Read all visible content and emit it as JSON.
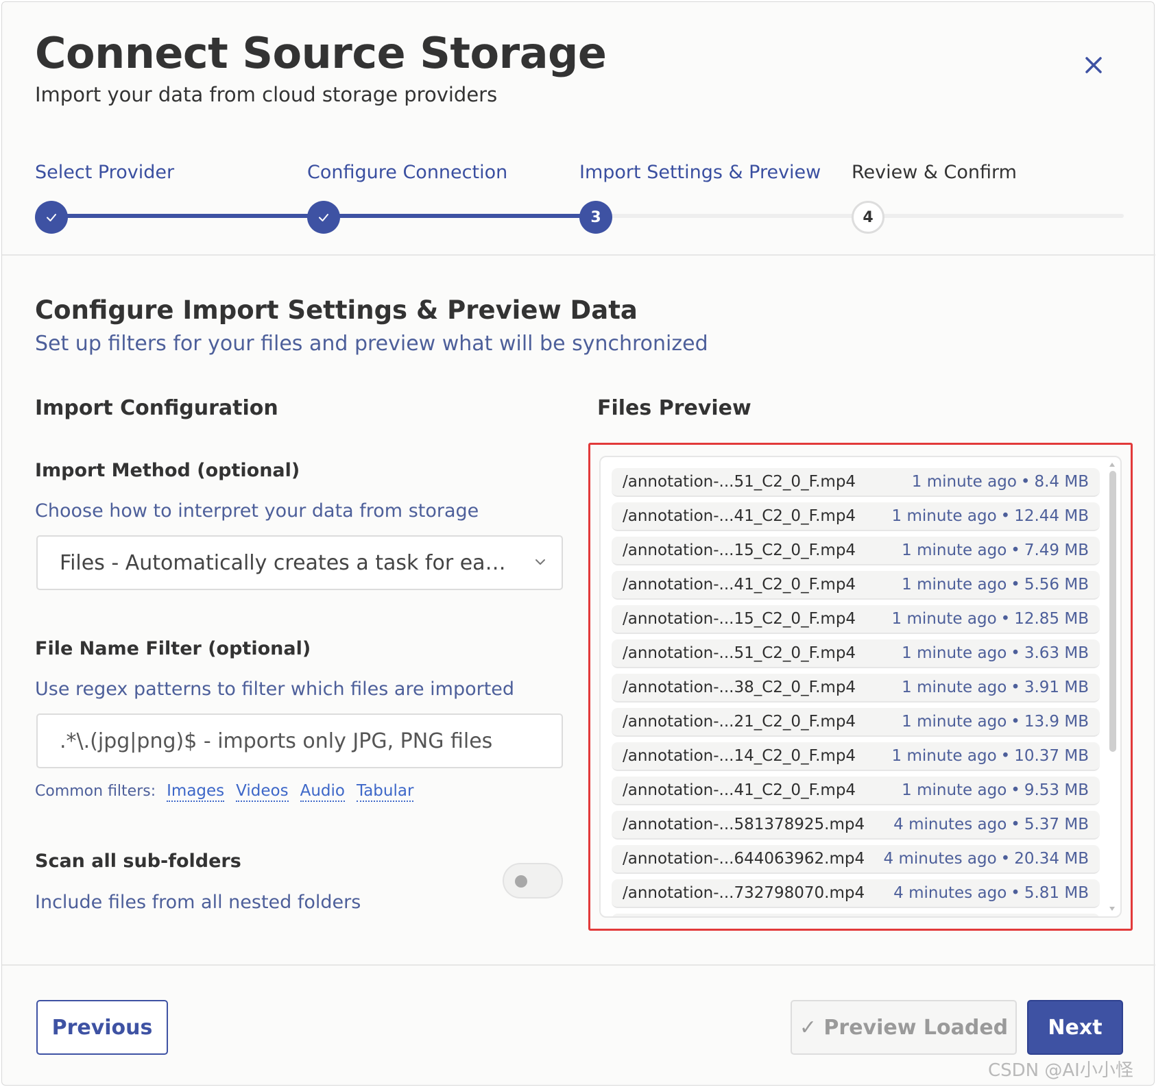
{
  "dialog": {
    "title": "Connect Source Storage",
    "subtitle": "Import your data from cloud storage providers"
  },
  "steps": [
    {
      "label": "Select Provider",
      "state": "complete",
      "marker": "✓"
    },
    {
      "label": "Configure Connection",
      "state": "complete",
      "marker": "✓"
    },
    {
      "label": "Import Settings & Preview",
      "state": "active",
      "marker": "3"
    },
    {
      "label": "Review & Confirm",
      "state": "pending",
      "marker": "4"
    }
  ],
  "section": {
    "title": "Configure Import Settings & Preview Data",
    "subtitle": "Set up filters for your files and preview what will be synchronized"
  },
  "import_config": {
    "heading": "Import Configuration",
    "method": {
      "label": "Import Method (optional)",
      "help": "Choose how to interpret your data from storage",
      "selected": "Files - Automatically creates a task for each s..."
    },
    "filter": {
      "label": "File Name Filter (optional)",
      "help": "Use regex patterns to filter which files are imported",
      "placeholder": ".*\\.(jpg|png)$ - imports only JPG, PNG files",
      "common_label": "Common filters:",
      "common": [
        "Images",
        "Videos",
        "Audio",
        "Tabular"
      ]
    },
    "scan": {
      "label": "Scan all sub-folders",
      "help": "Include files from all nested folders",
      "enabled": false
    }
  },
  "preview": {
    "heading": "Files Preview",
    "files": [
      {
        "name": "/annotation-...51_C2_0_F.mp4",
        "time": "1 minute ago",
        "size": "8.4 MB"
      },
      {
        "name": "/annotation-...41_C2_0_F.mp4",
        "time": "1 minute ago",
        "size": "12.44 MB"
      },
      {
        "name": "/annotation-...15_C2_0_F.mp4",
        "time": "1 minute ago",
        "size": "7.49 MB"
      },
      {
        "name": "/annotation-...41_C2_0_F.mp4",
        "time": "1 minute ago",
        "size": "5.56 MB"
      },
      {
        "name": "/annotation-...15_C2_0_F.mp4",
        "time": "1 minute ago",
        "size": "12.85 MB"
      },
      {
        "name": "/annotation-...51_C2_0_F.mp4",
        "time": "1 minute ago",
        "size": "3.63 MB"
      },
      {
        "name": "/annotation-...38_C2_0_F.mp4",
        "time": "1 minute ago",
        "size": "3.91 MB"
      },
      {
        "name": "/annotation-...21_C2_0_F.mp4",
        "time": "1 minute ago",
        "size": "13.9 MB"
      },
      {
        "name": "/annotation-...14_C2_0_F.mp4",
        "time": "1 minute ago",
        "size": "10.37 MB"
      },
      {
        "name": "/annotation-...41_C2_0_F.mp4",
        "time": "1 minute ago",
        "size": "9.53 MB"
      },
      {
        "name": "/annotation-...581378925.mp4",
        "time": "4 minutes ago",
        "size": "5.37 MB"
      },
      {
        "name": "/annotation-...644063962.mp4",
        "time": "4 minutes ago",
        "size": "20.34 MB"
      },
      {
        "name": "/annotation-...732798070.mp4",
        "time": "4 minutes ago",
        "size": "5.81 MB"
      }
    ]
  },
  "footer": {
    "previous": "Previous",
    "preview_loaded": "✓ Preview Loaded",
    "next": "Next"
  },
  "watermark": "CSDN @AI小小怪",
  "colors": {
    "primary": "#3e52a3",
    "link": "#3d67c8",
    "help_text": "#4d5f9a",
    "highlight_border": "#e23a3a",
    "pending_track": "#eeeeee"
  },
  "icons": {
    "close": "close-icon",
    "step_done": "check-icon",
    "select": "chevron-down-icon"
  }
}
